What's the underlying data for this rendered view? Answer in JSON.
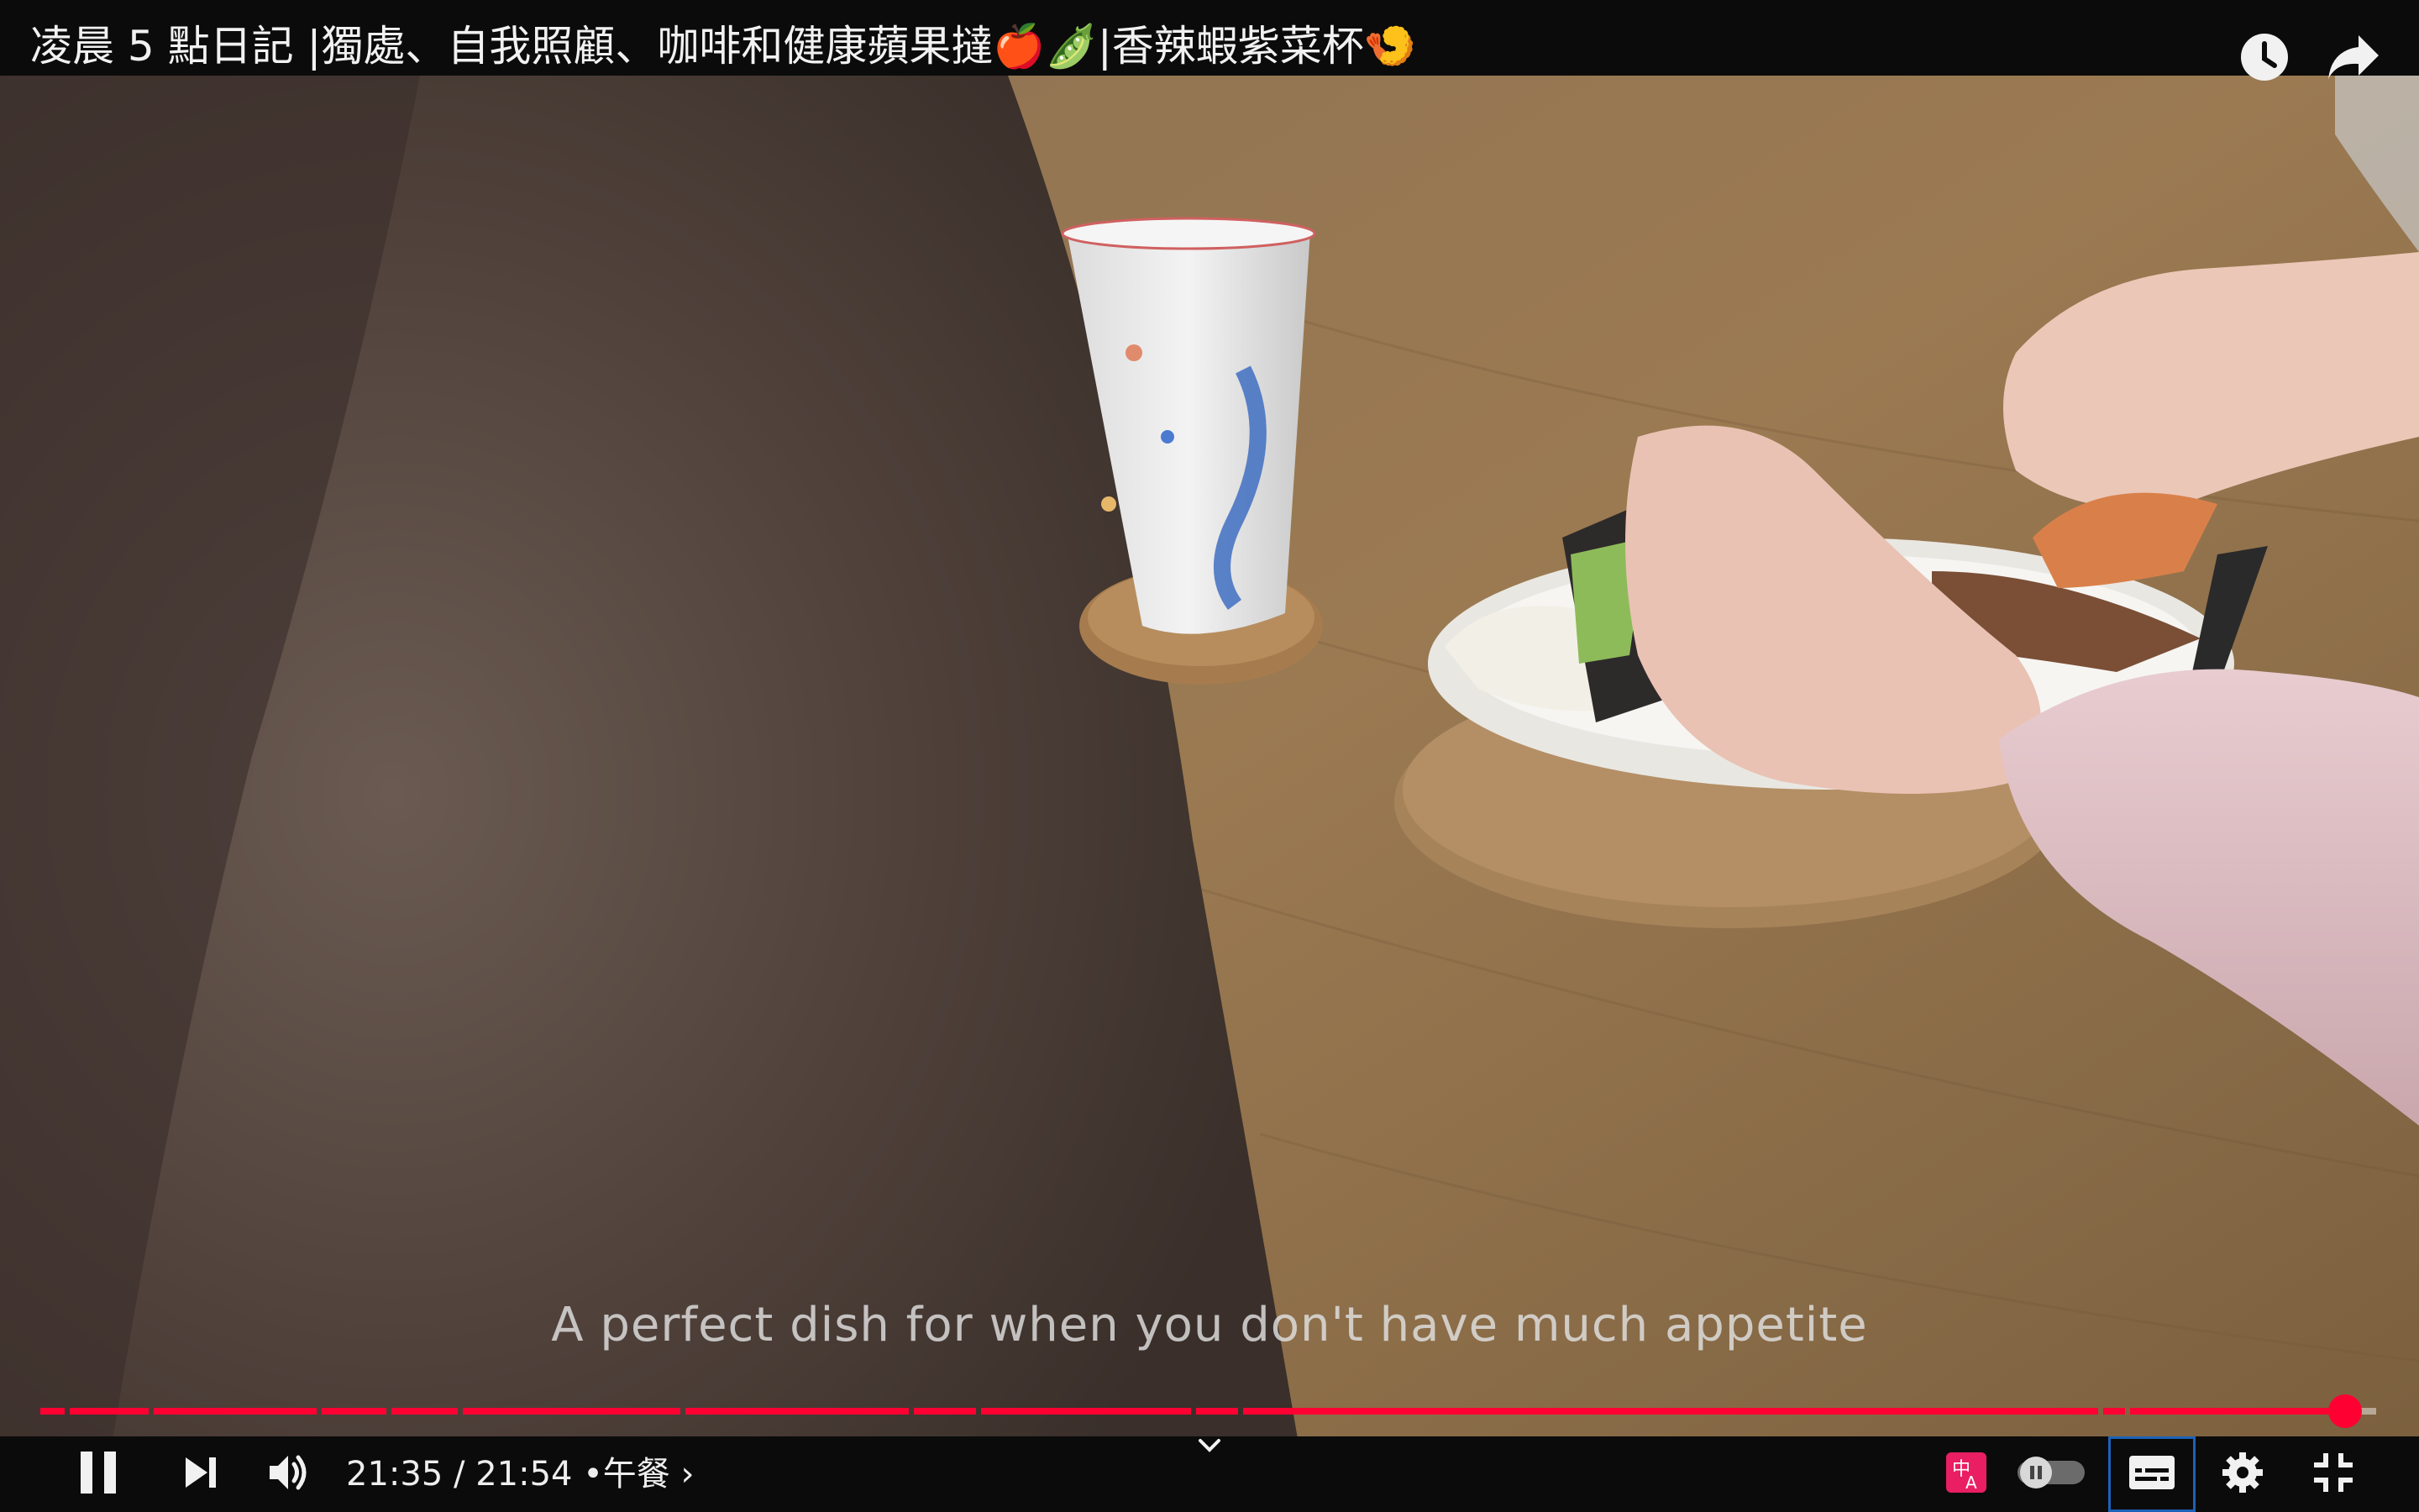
{
  "title": "凌晨 5 點日記 |獨處、自我照顧、咖啡和健康蘋果撻🍎🫛|香辣蝦紫菜杯🍤",
  "caption": "A perfect dish for when you don't have much appetite",
  "player": {
    "current_time": "21:35",
    "time_separator": "/",
    "duration": "21:54",
    "chapter_bullet": "•",
    "chapter": "午餐",
    "chapter_chevron": "›",
    "progress_fraction": 0.9856
  },
  "colors": {
    "accent": "#ff0033",
    "bar_bg": "#0b0b0b",
    "focus_ring": "#1c62b9",
    "autotranslate_badge": "#e91e63"
  },
  "icons": {
    "watch_later": "clock-icon",
    "share": "share-arrow-icon",
    "play_pause": "pause-icon",
    "next": "next-icon",
    "volume": "volume-icon",
    "expand": "chevron-down-icon",
    "auto_translate": "translate-icon",
    "autoplay": "autoplay-toggle-icon",
    "subtitles": "subtitles-icon",
    "settings": "gear-icon",
    "fullscreen_exit": "exit-fullscreen-icon"
  }
}
